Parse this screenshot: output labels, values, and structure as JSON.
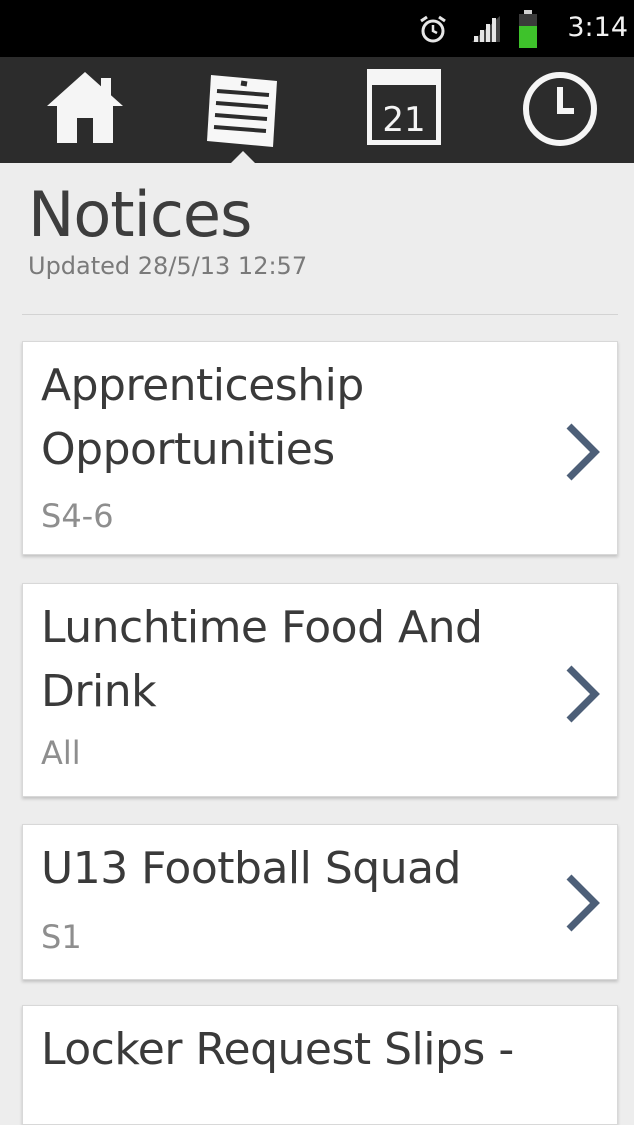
{
  "status_bar": {
    "time": "3:14",
    "icons": [
      "alarm-icon",
      "signal-icon",
      "battery-icon"
    ],
    "battery_color": "#3ec22b"
  },
  "nav": {
    "items": [
      {
        "name": "home",
        "icon": "home-icon"
      },
      {
        "name": "notices",
        "icon": "notes-icon",
        "selected": true
      },
      {
        "name": "calendar",
        "icon": "calendar-icon",
        "label": "21"
      },
      {
        "name": "clock",
        "icon": "clock-icon"
      }
    ]
  },
  "page": {
    "title": "Notices",
    "updated": "Updated 28/5/13 12:57"
  },
  "notices": [
    {
      "title": "Apprenticeship Opportunities",
      "audience": "S4-6"
    },
    {
      "title": "Lunchtime Food And Drink",
      "audience": "All"
    },
    {
      "title": "U13 Football Squad",
      "audience": "S1"
    },
    {
      "title": "Locker Request Slips -",
      "audience": ""
    }
  ],
  "colors": {
    "nav_bg": "#2c2c2c",
    "page_bg": "#ededed",
    "chevron": "#4d5f78"
  }
}
